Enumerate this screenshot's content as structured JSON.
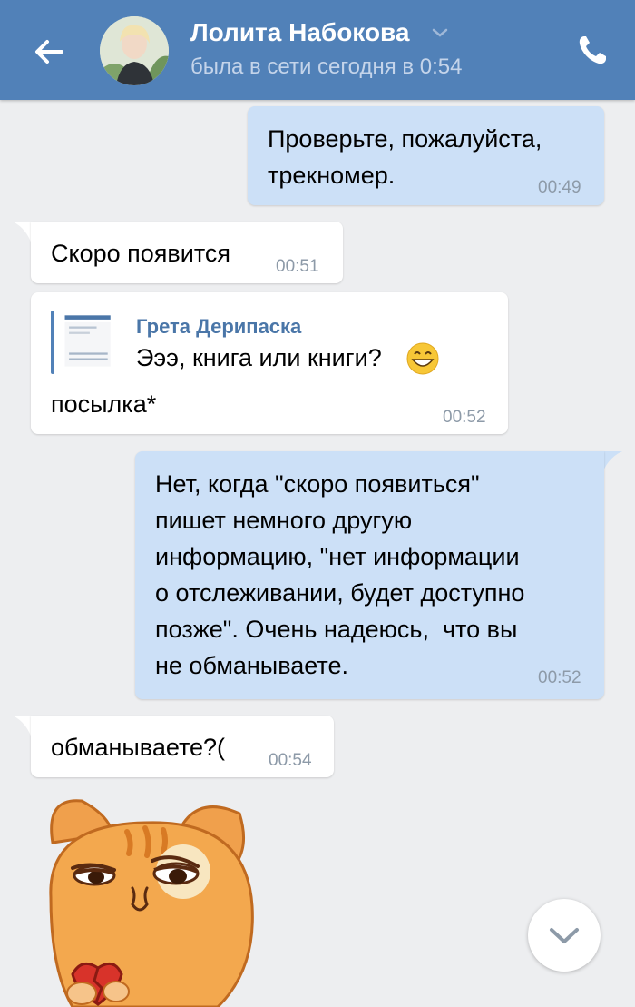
{
  "header": {
    "contact_name": "Лолита Набокова",
    "status": "была в сети сегодня в 0:54",
    "icons": [
      "back-arrow-icon",
      "chevron-down-icon",
      "phone-icon"
    ]
  },
  "messages": [
    {
      "direction": "out",
      "text_lines": [
        "Проверьте, пожалуйста,",
        "трекномер."
      ],
      "time": "00:49"
    },
    {
      "direction": "in",
      "text": "Скоро появится",
      "time": "00:51"
    },
    {
      "direction": "in",
      "forwarded": {
        "author": "Грета Дерипаска",
        "text": "Эээ, книга или книги?",
        "emoji": "grinning-face-emoji"
      },
      "text": "посылка*",
      "time": "00:52"
    },
    {
      "direction": "out",
      "text_lines": [
        "Нет, когда \"скоро появиться\"",
        "пишет немного другую",
        "информацию, \"нет информации",
        "о отслеживании, будет доступно",
        "позже\". Очень надеюсь,  что вы",
        "не обманываете."
      ],
      "time": "00:52"
    },
    {
      "direction": "in",
      "text": "обманываете?(",
      "time": "00:54"
    }
  ],
  "sticker": {
    "name": "sad-cat-sticker"
  },
  "scroll_button": {
    "icon": "chevron-down-icon"
  },
  "colors": {
    "header": "#5181b8",
    "background": "#edeef0",
    "outgoing_bubble": "#cce0f7",
    "incoming_bubble": "#ffffff",
    "link": "#4a76a8",
    "time": "#8d9aa8"
  }
}
